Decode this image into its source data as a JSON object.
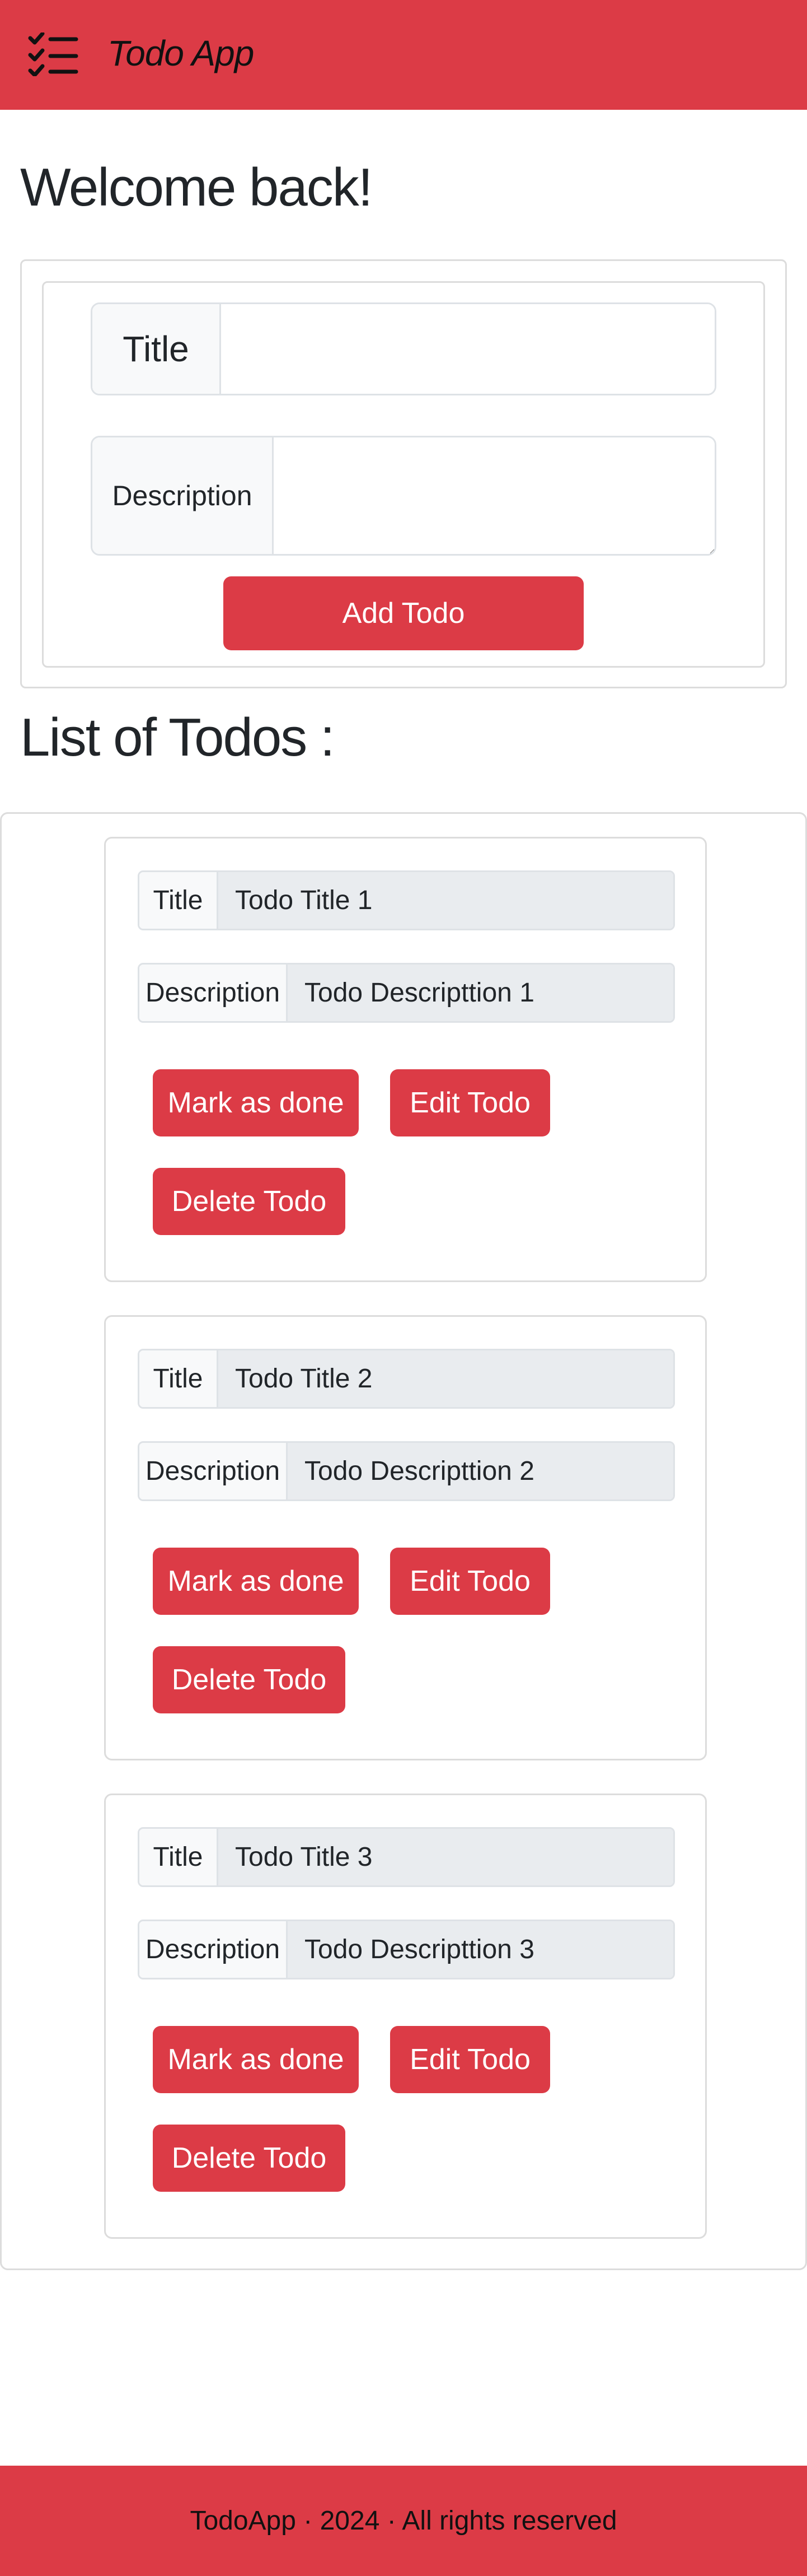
{
  "navbar": {
    "brand": "Todo App",
    "icon": "checklist-icon",
    "color": "#dc3b46"
  },
  "welcome": "Welcome back!",
  "form": {
    "title_label": "Title",
    "title_value": "",
    "description_label": "Description",
    "description_value": "",
    "add_button": "Add Todo"
  },
  "list_heading": "List of Todos :",
  "todos": [
    {
      "title_label": "Title",
      "title": "Todo Title 1",
      "description_label": "Description",
      "description": "Todo Descripttion 1",
      "done_label": "Mark as done",
      "edit_label": "Edit Todo",
      "delete_label": "Delete Todo"
    },
    {
      "title_label": "Title",
      "title": "Todo Title 2",
      "description_label": "Description",
      "description": "Todo Descripttion 2",
      "done_label": "Mark as done",
      "edit_label": "Edit Todo",
      "delete_label": "Delete Todo"
    },
    {
      "title_label": "Title",
      "title": "Todo Title 3",
      "description_label": "Description",
      "description": "Todo Descripttion 3",
      "done_label": "Mark as done",
      "edit_label": "Edit Todo",
      "delete_label": "Delete Todo"
    }
  ],
  "footer": "TodoApp · 2024 · All rights reserved"
}
